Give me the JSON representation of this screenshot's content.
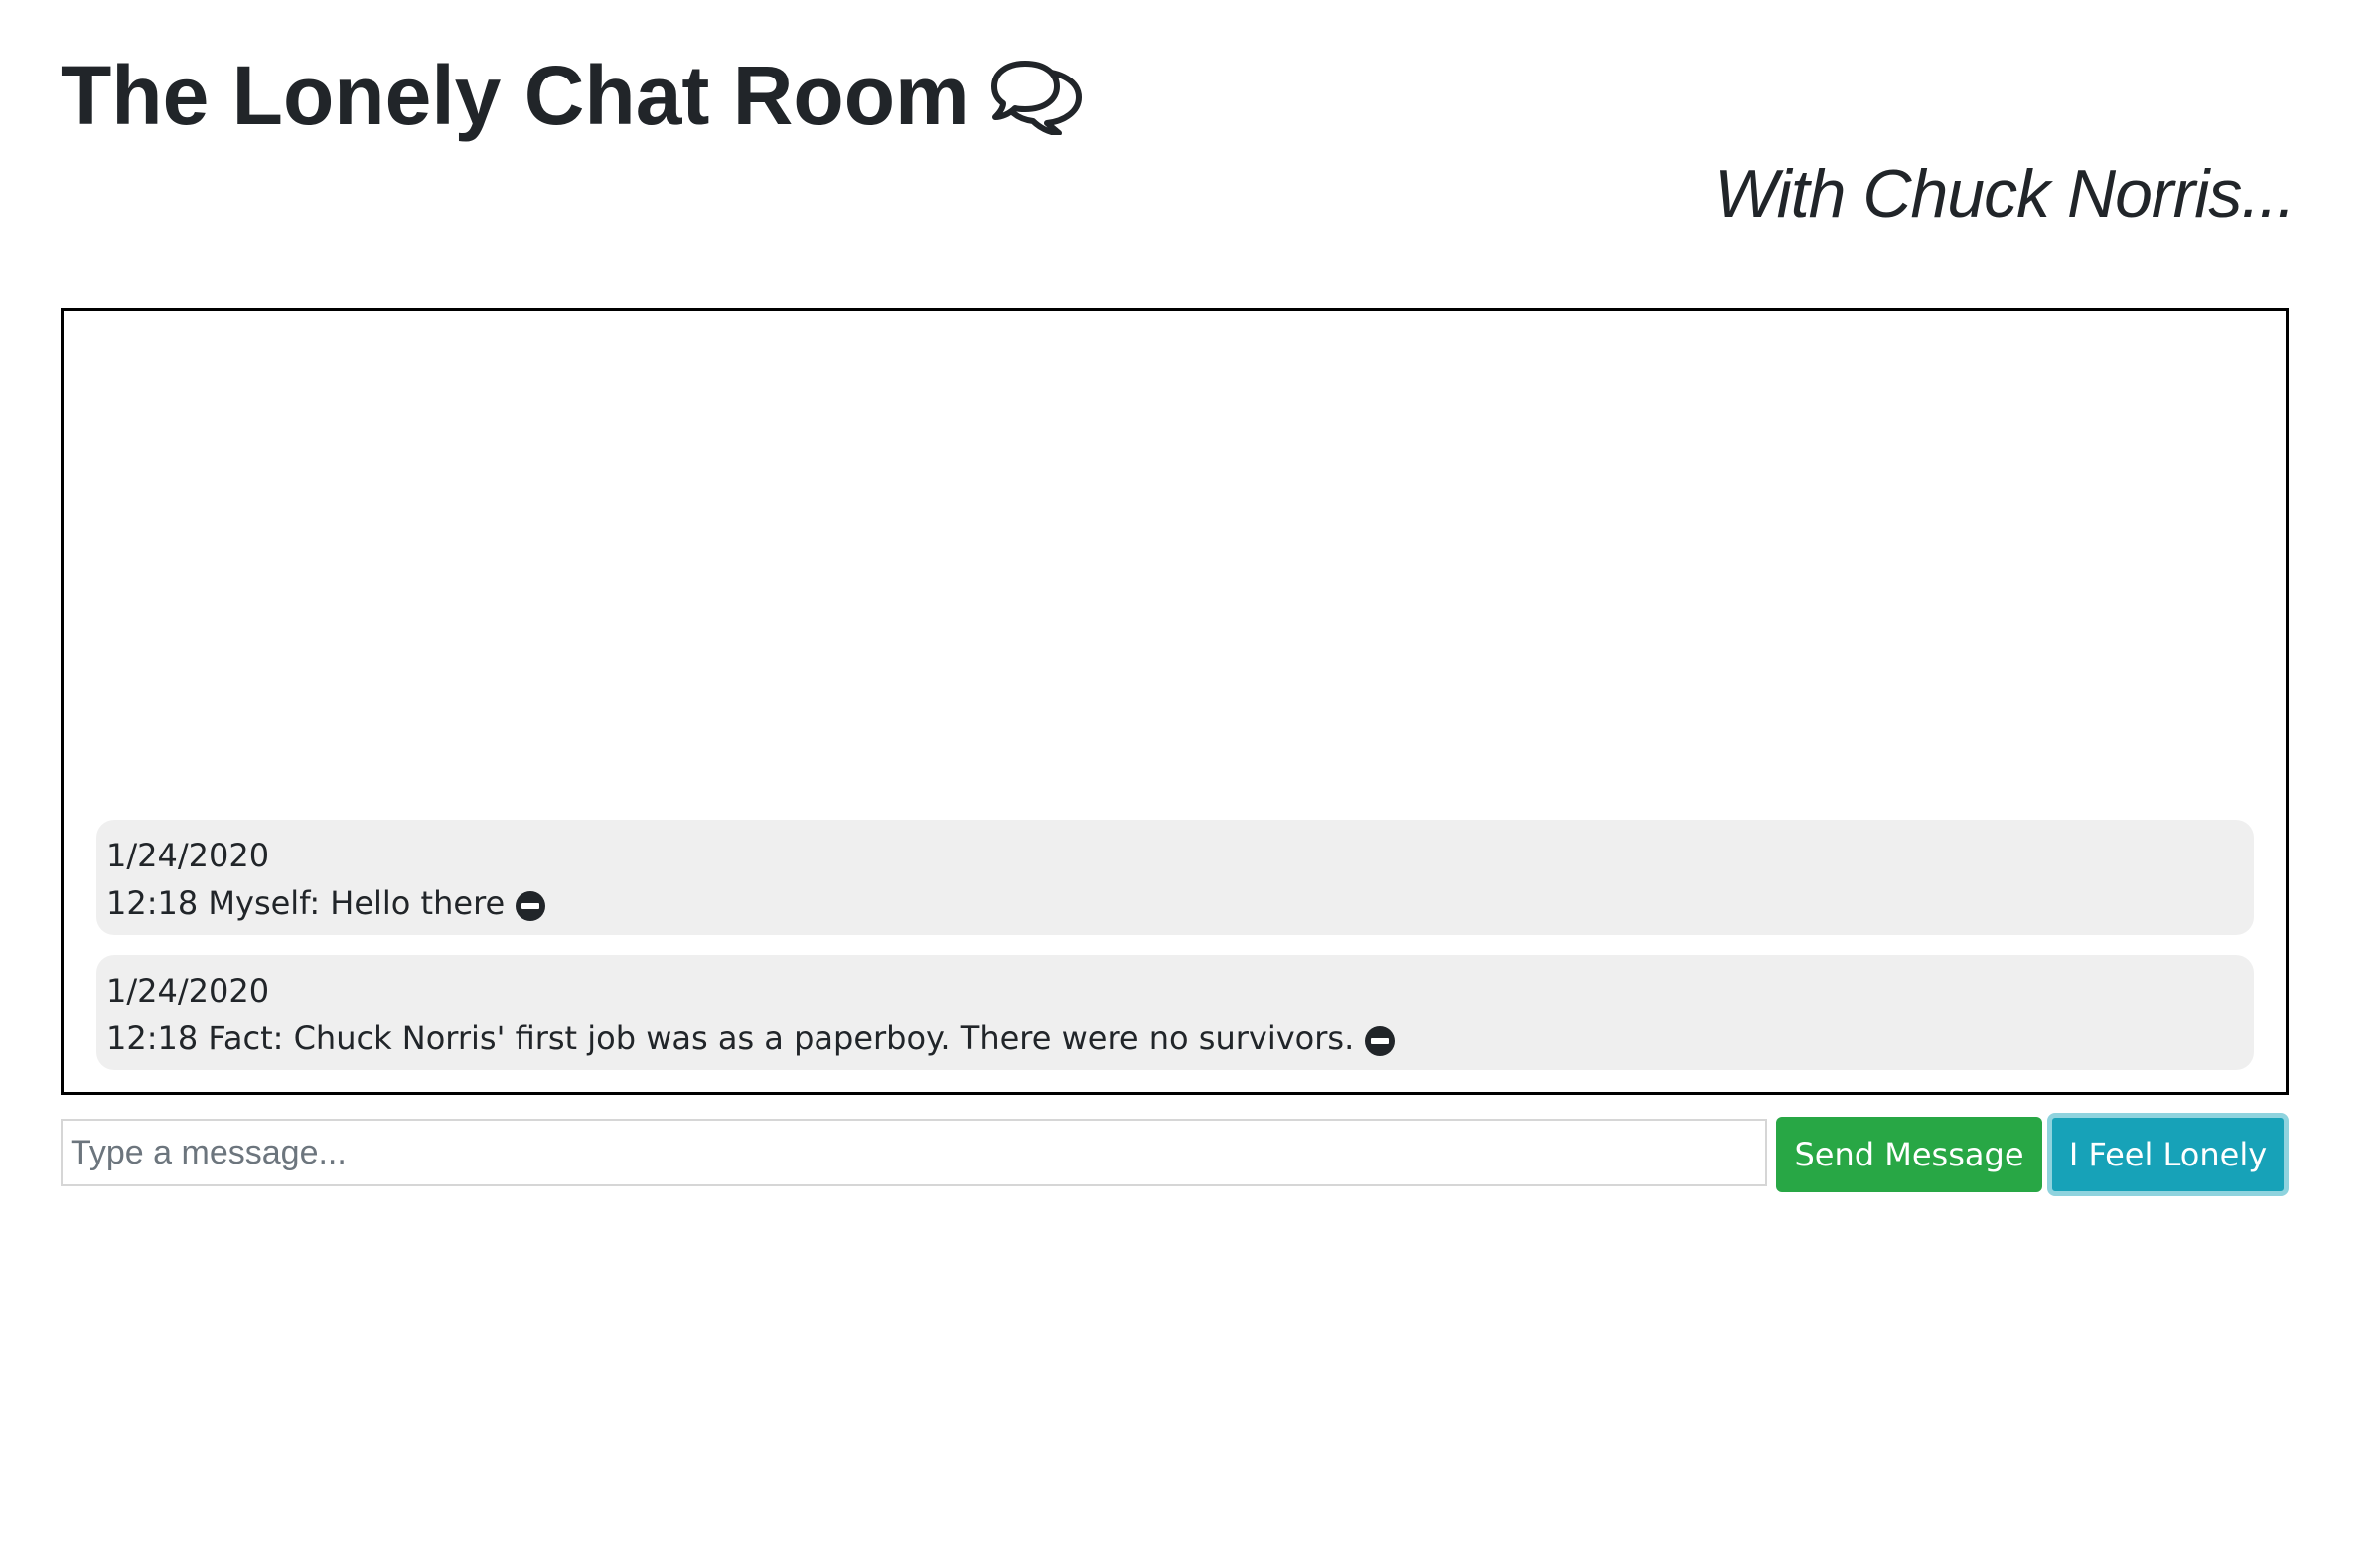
{
  "header": {
    "title": "The Lonely Chat Room",
    "title_icon": "chat-bubbles-icon",
    "subtitle": "With Chuck Norris..."
  },
  "chat": {
    "messages": [
      {
        "date": "1/24/2020",
        "text": "12:18 Myself: Hello there",
        "action_icon": "remove-circle-icon"
      },
      {
        "date": "1/24/2020",
        "text": "12:18 Fact: Chuck Norris' first job was as a paperboy. There were no survivors.",
        "action_icon": "remove-circle-icon"
      }
    ]
  },
  "composer": {
    "input_value": "",
    "input_placeholder": "Type a message...",
    "send_label": "Send Message",
    "lonely_label": "I Feel Lonely"
  },
  "colors": {
    "text": "#212529",
    "message_bg": "#efefef",
    "send_button": "#28a745",
    "lonely_button": "#17a2b8",
    "chat_border": "#000000"
  }
}
